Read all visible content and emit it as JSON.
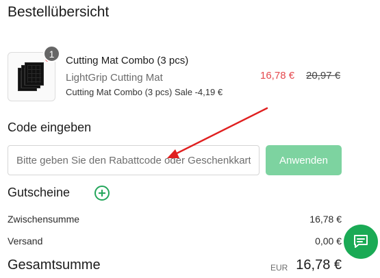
{
  "header": {
    "title": "Bestellübersicht"
  },
  "product": {
    "quantity": "1",
    "name": "Cutting Mat Combo (3 pcs)",
    "variant": "LightGrip Cutting Mat",
    "sale_note": "Cutting Mat Combo (3 pcs) Sale -4,19 €",
    "price": "16,78 €",
    "original_price": "20,97 €"
  },
  "code": {
    "heading": "Code eingeben",
    "placeholder": "Bitte geben Sie den Rabattcode oder Geschenkkarte ein",
    "apply_label": "Anwenden"
  },
  "coupons": {
    "heading": "Gutscheine"
  },
  "summary": {
    "subtotal_label": "Zwischensumme",
    "subtotal_value": "16,78 €",
    "shipping_label": "Versand",
    "shipping_value": "0,00 €",
    "total_label": "Gesamtsumme",
    "total_currency": "EUR",
    "total_value": "16,78 €"
  },
  "colors": {
    "accent_green": "#1aaa55",
    "button_green_disabled": "#7dd3a0",
    "sale_red": "#e5484d",
    "annotation_arrow": "#e02020"
  },
  "icons": [
    "plus-circle-icon",
    "chat-icon",
    "annotation-arrow"
  ]
}
